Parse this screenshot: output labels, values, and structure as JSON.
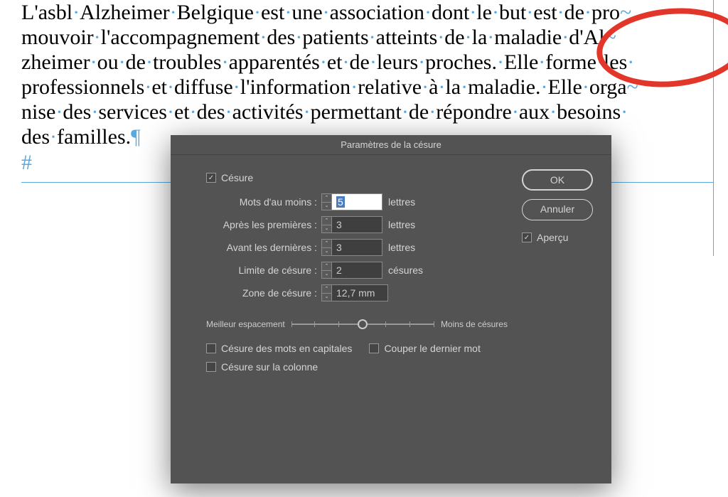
{
  "document": {
    "line1_pre": "L'asbl·Alzheimer·Belgique·est·une·association·dont·le·but·est·de·pro",
    "line1_hyph": "~",
    "line2_pre": "mouvoir·l'accompagnement·des·patients·atteints·de·la·maladie·d'Al",
    "line2_hyph": "~",
    "line3": "zheimer·ou·de·troubles·apparentés·et·de·leurs·proches.·Elle·forme·les·",
    "line4_pre": "professionnels·et·diffuse·l'information·relative·à·la·maladie.·Elle·orga",
    "line4_hyph": "~",
    "line5": "nise·des·services·et·des·activités·permettant·de·répondre·aux·besoins·",
    "line6_pre": "des·familles.",
    "pilcrow": "¶",
    "hash": "#"
  },
  "dialog": {
    "title": "Paramètres de la césure",
    "hyphenate_label": "Césure",
    "words_at_least": {
      "label": "Mots d'au moins :",
      "value": "5",
      "unit": "lettres"
    },
    "after_first": {
      "label": "Après les premières :",
      "value": "3",
      "unit": "lettres"
    },
    "before_last": {
      "label": "Avant les dernières :",
      "value": "3",
      "unit": "lettres"
    },
    "hyphen_limit": {
      "label": "Limite de césure :",
      "value": "2",
      "unit": "césures"
    },
    "hyphen_zone": {
      "label": "Zone de césure :",
      "value": "12,7 mm",
      "unit": ""
    },
    "slider_left": "Meilleur espacement",
    "slider_right": "Moins de césures",
    "opt_caps": "Césure des mots en capitales",
    "opt_last_word": "Couper le dernier mot",
    "opt_column": "Césure sur la colonne",
    "ok": "OK",
    "cancel": "Annuler",
    "preview": "Aperçu"
  }
}
